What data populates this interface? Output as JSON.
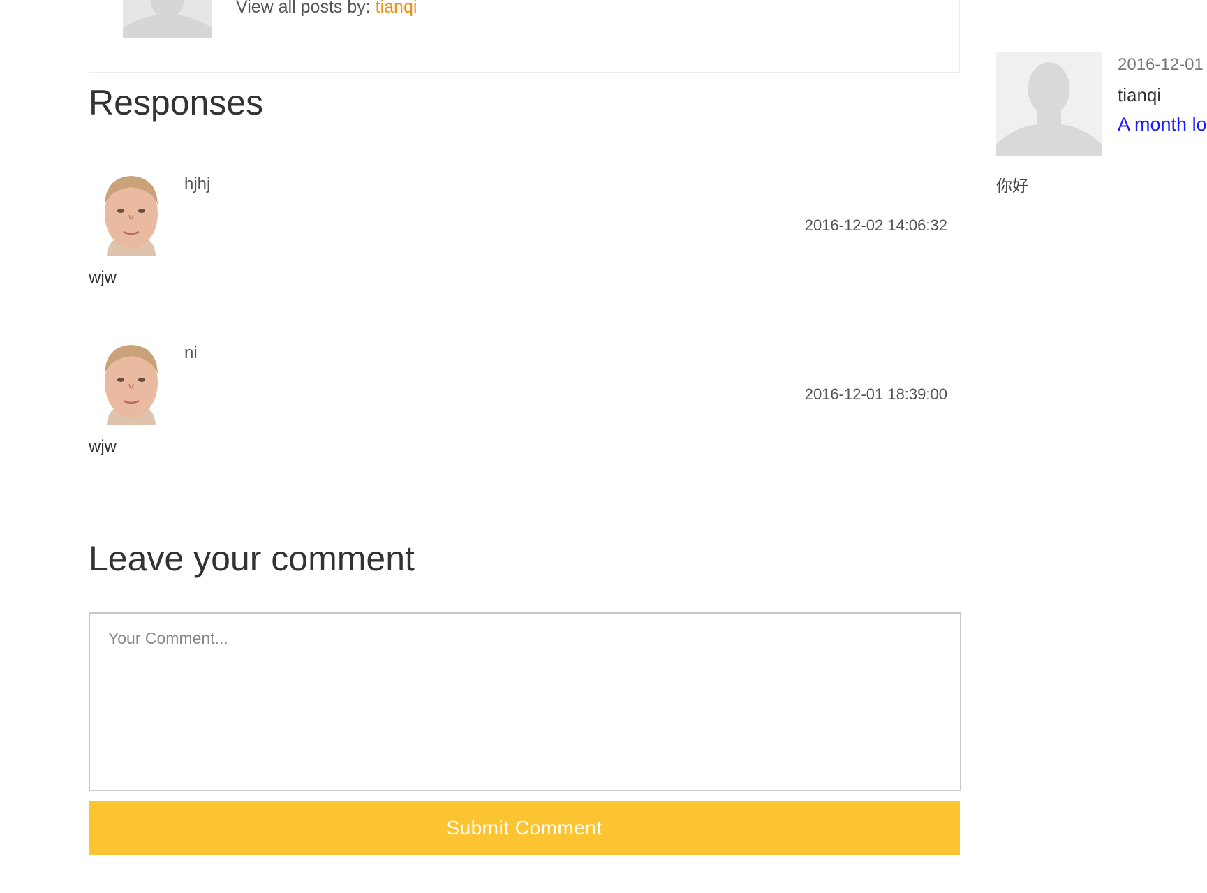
{
  "author_box": {
    "view_all_label": "View all posts by:",
    "author_name": "tianqi"
  },
  "responses": {
    "heading": "Responses",
    "comments": [
      {
        "author": "hjhj",
        "date": "2016-12-02 14:06:32",
        "body": "wjw"
      },
      {
        "author": "ni",
        "date": "2016-12-01 18:39:00",
        "body": "wjw"
      }
    ]
  },
  "comment_form": {
    "heading": "Leave your comment",
    "placeholder": "Your Comment...",
    "submit_label": "Submit Comment"
  },
  "sidebar": {
    "date": "2016-12-01",
    "author": "tianqi",
    "link_text": "A month lo",
    "text": "你好"
  },
  "colors": {
    "accent_orange": "#f0900f",
    "submit_yellow": "#fdc431",
    "link_blue": "#1a1aff"
  }
}
